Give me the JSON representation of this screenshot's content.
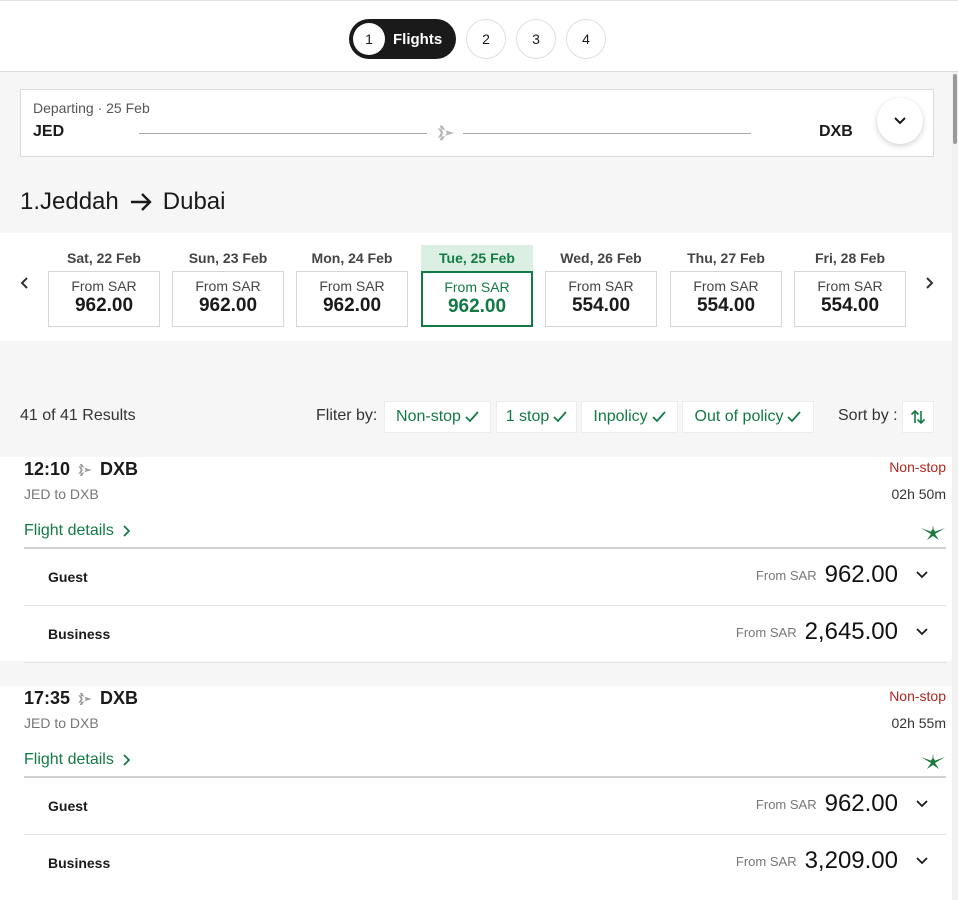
{
  "stepper": {
    "active_num": "1",
    "active_label": "Flights",
    "steps": [
      "2",
      "3",
      "4"
    ]
  },
  "route": {
    "departing": "Departing · 25 Feb",
    "from": "JED",
    "to": "DXB"
  },
  "trip": {
    "prefix": "1.",
    "origin": "Jeddah",
    "destination": "Dubai"
  },
  "dates": [
    {
      "label": "Sat, 22 Feb",
      "from": "From SAR",
      "price": "962.00"
    },
    {
      "label": "Sun, 23 Feb",
      "from": "From SAR",
      "price": "962.00"
    },
    {
      "label": "Mon, 24 Feb",
      "from": "From SAR",
      "price": "962.00"
    },
    {
      "label": "Tue, 25 Feb",
      "from": "From SAR",
      "price": "962.00"
    },
    {
      "label": "Wed, 26 Feb",
      "from": "From SAR",
      "price": "554.00"
    },
    {
      "label": "Thu, 27 Feb",
      "from": "From SAR",
      "price": "554.00"
    },
    {
      "label": "Fri, 28 Feb",
      "from": "From SAR",
      "price": "554.00"
    }
  ],
  "results": {
    "count": "41 of 41 Results",
    "filter_label": "Fliter by:",
    "filters": [
      "Non-stop",
      "1 stop",
      "Inpolicy",
      "Out of policy"
    ],
    "sort_label": "Sort by :"
  },
  "flights": [
    {
      "time": "12:10",
      "dest": "DXB",
      "route": "JED to DXB",
      "stops": "Non-stop",
      "duration": "02h 50m",
      "details": "Flight details",
      "fares": [
        {
          "name": "Guest",
          "from": "From SAR",
          "amount": "962.00"
        },
        {
          "name": "Business",
          "from": "From SAR",
          "amount": "2,645.00"
        }
      ]
    },
    {
      "time": "17:35",
      "dest": "DXB",
      "route": "JED to DXB",
      "stops": "Non-stop",
      "duration": "02h 55m",
      "details": "Flight details",
      "fares": [
        {
          "name": "Guest",
          "from": "From SAR",
          "amount": "962.00"
        },
        {
          "name": "Business",
          "from": "From SAR",
          "amount": "3,209.00"
        }
      ]
    }
  ],
  "colors": {
    "accent": "#137a45",
    "selected_bg": "#dbf0e2",
    "non_stop": "#b3261e",
    "dark": "#1a1a1a"
  },
  "icons": {
    "plane": "plane-icon",
    "expand": "chevron-down-icon",
    "arrow": "arrow-right-icon",
    "prev": "chevron-left-icon",
    "next": "chevron-right-icon",
    "check": "check-icon",
    "sort": "sort-icon",
    "airline": "airline-logo-icon"
  }
}
